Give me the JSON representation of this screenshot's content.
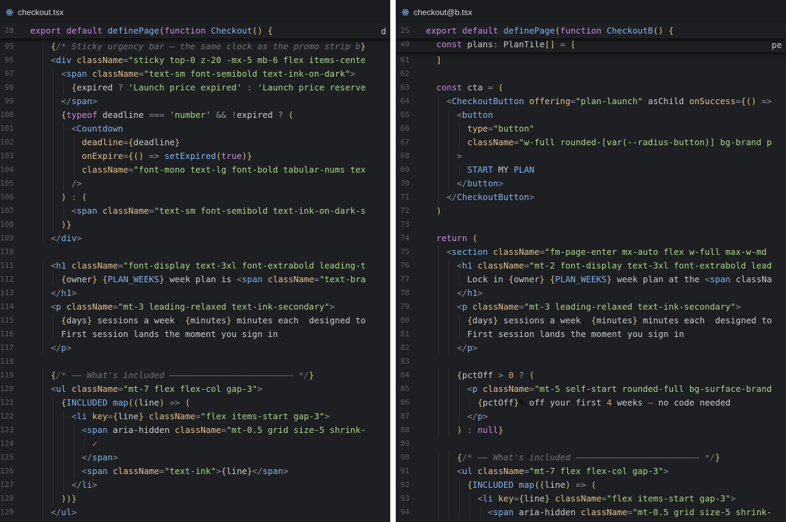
{
  "left": {
    "tab": {
      "icon": "react-icon",
      "name": "checkout.tsx"
    },
    "sticky": [
      {
        "n": "28",
        "code": "export default definePage(function Checkout() {",
        "trail": "d"
      }
    ],
    "lines": [
      {
        "n": "95",
        "code": "    {/* Sticky urgency bar — the same clock as the promo strip be"
      },
      {
        "n": "96",
        "code": "    <div className=\"sticky top-0 z-20 -mx-5 mb-6 flex items-cente"
      },
      {
        "n": "97",
        "code": "      <span className=\"text-sm font-semibold text-ink-on-dark\">"
      },
      {
        "n": "98",
        "code": "        {expired ? 'Launch price expired' : 'Launch price reserve"
      },
      {
        "n": "99",
        "code": "      </span>"
      },
      {
        "n": "100",
        "code": "      {typeof deadline === 'number' && !expired ? ("
      },
      {
        "n": "101",
        "code": "        <Countdown"
      },
      {
        "n": "102",
        "code": "          deadline={deadline}"
      },
      {
        "n": "103",
        "code": "          onExpire={() => setExpired(true)}"
      },
      {
        "n": "104",
        "code": "          className=\"font-mono text-lg font-bold tabular-nums tex"
      },
      {
        "n": "105",
        "code": "        />"
      },
      {
        "n": "106",
        "code": "      ) : ("
      },
      {
        "n": "107",
        "code": "        <span className=\"text-sm font-semibold text-ink-on-dark-s"
      },
      {
        "n": "108",
        "code": "      )}"
      },
      {
        "n": "109",
        "code": "    </div>"
      },
      {
        "n": "110",
        "code": ""
      },
      {
        "n": "111",
        "code": "    <h1 className=\"font-display text-3xl font-extrabold leading-t"
      },
      {
        "n": "112",
        "code": "      {owner} {PLAN_WEEKS}-week plan is <span className=\"text-bra"
      },
      {
        "n": "113",
        "code": "    </h1>"
      },
      {
        "n": "114",
        "code": "    <p className=\"mt-3 leading-relaxed text-ink-secondary\">"
      },
      {
        "n": "115",
        "code": "      {days} sessions a week, {minutes} minutes each, designed to"
      },
      {
        "n": "116",
        "code": "      First session lands the moment you sign in."
      },
      {
        "n": "117",
        "code": "    </p>"
      },
      {
        "n": "118",
        "code": ""
      },
      {
        "n": "119",
        "code": "    {/* —— What's included ———————————————————————— */}"
      },
      {
        "n": "120",
        "code": "    <ul className=\"mt-7 flex flex-col gap-3\">"
      },
      {
        "n": "121",
        "code": "      {INCLUDED.map((line) => ("
      },
      {
        "n": "122",
        "code": "        <li key={line} className=\"flex items-start gap-3\">"
      },
      {
        "n": "123",
        "code": "          <span aria-hidden className=\"mt-0.5 grid size-5 shrink-"
      },
      {
        "n": "124",
        "code": "            ✓"
      },
      {
        "n": "125",
        "code": "          </span>"
      },
      {
        "n": "126",
        "code": "          <span className=\"text-ink\">{line}</span>"
      },
      {
        "n": "127",
        "code": "        </li>"
      },
      {
        "n": "128",
        "code": "      ))}"
      },
      {
        "n": "129",
        "code": "    </ul>"
      }
    ]
  },
  "right": {
    "tab": {
      "icon": "react-icon",
      "name": "checkout@b.tsx"
    },
    "sticky": [
      {
        "n": "25",
        "code": "export default definePage(function CheckoutB() {",
        "trail": ""
      },
      {
        "n": "49",
        "code": "  const plans: PlanTile[] = [",
        "trail": "pe"
      }
    ],
    "lines": [
      {
        "n": "61",
        "code": "  ]"
      },
      {
        "n": "62",
        "code": ""
      },
      {
        "n": "63",
        "code": "  const cta = ("
      },
      {
        "n": "64",
        "code": "    <CheckoutButton offering=\"plan-launch\" asChild onSuccess={() =>"
      },
      {
        "n": "65",
        "code": "      <button"
      },
      {
        "n": "66",
        "code": "        type=\"button\""
      },
      {
        "n": "67",
        "code": "        className=\"w-full rounded-[var(--radius-button)] bg-brand p"
      },
      {
        "n": "68",
        "code": "      >"
      },
      {
        "n": "69",
        "code": "        START MY PLAN"
      },
      {
        "n": "70",
        "code": "      </button>"
      },
      {
        "n": "71",
        "code": "    </CheckoutButton>"
      },
      {
        "n": "72",
        "code": "  )"
      },
      {
        "n": "73",
        "code": ""
      },
      {
        "n": "74",
        "code": "  return ("
      },
      {
        "n": "75",
        "code": "    <section className=\"fm-page-enter mx-auto flex w-full max-w-md"
      },
      {
        "n": "76",
        "code": "      <h1 className=\"mt-2 font-display text-3xl font-extrabold lead"
      },
      {
        "n": "77",
        "code": "        Lock in {owner} {PLAN_WEEKS}-week plan at the <span classNa"
      },
      {
        "n": "78",
        "code": "      </h1>"
      },
      {
        "n": "79",
        "code": "      <p className=\"mt-3 leading-relaxed text-ink-secondary\">"
      },
      {
        "n": "80",
        "code": "        {days} sessions a week, {minutes} minutes each, designed to"
      },
      {
        "n": "81",
        "code": "        First session lands the moment you sign in."
      },
      {
        "n": "82",
        "code": "      </p>"
      },
      {
        "n": "83",
        "code": ""
      },
      {
        "n": "84",
        "code": "      {pctOff > 0 ? ("
      },
      {
        "n": "85",
        "code": "        <p className=\"mt-5 self-start rounded-full bg-surface-brand"
      },
      {
        "n": "86",
        "code": "          {pctOff}% off your first 4 weeks — no code needed"
      },
      {
        "n": "87",
        "code": "        </p>"
      },
      {
        "n": "88",
        "code": "      ) : null}"
      },
      {
        "n": "89",
        "code": ""
      },
      {
        "n": "90",
        "code": "      {/* —— What's included ———————————————————————— */}"
      },
      {
        "n": "91",
        "code": "      <ul className=\"mt-7 flex flex-col gap-3\">"
      },
      {
        "n": "92",
        "code": "        {INCLUDED.map((line) => ("
      },
      {
        "n": "93",
        "code": "          <li key={line} className=\"flex items-start gap-3\">"
      },
      {
        "n": "94",
        "code": "            <span aria-hidden className=\"mt-0.5 grid size-5 shrink-"
      }
    ]
  }
}
